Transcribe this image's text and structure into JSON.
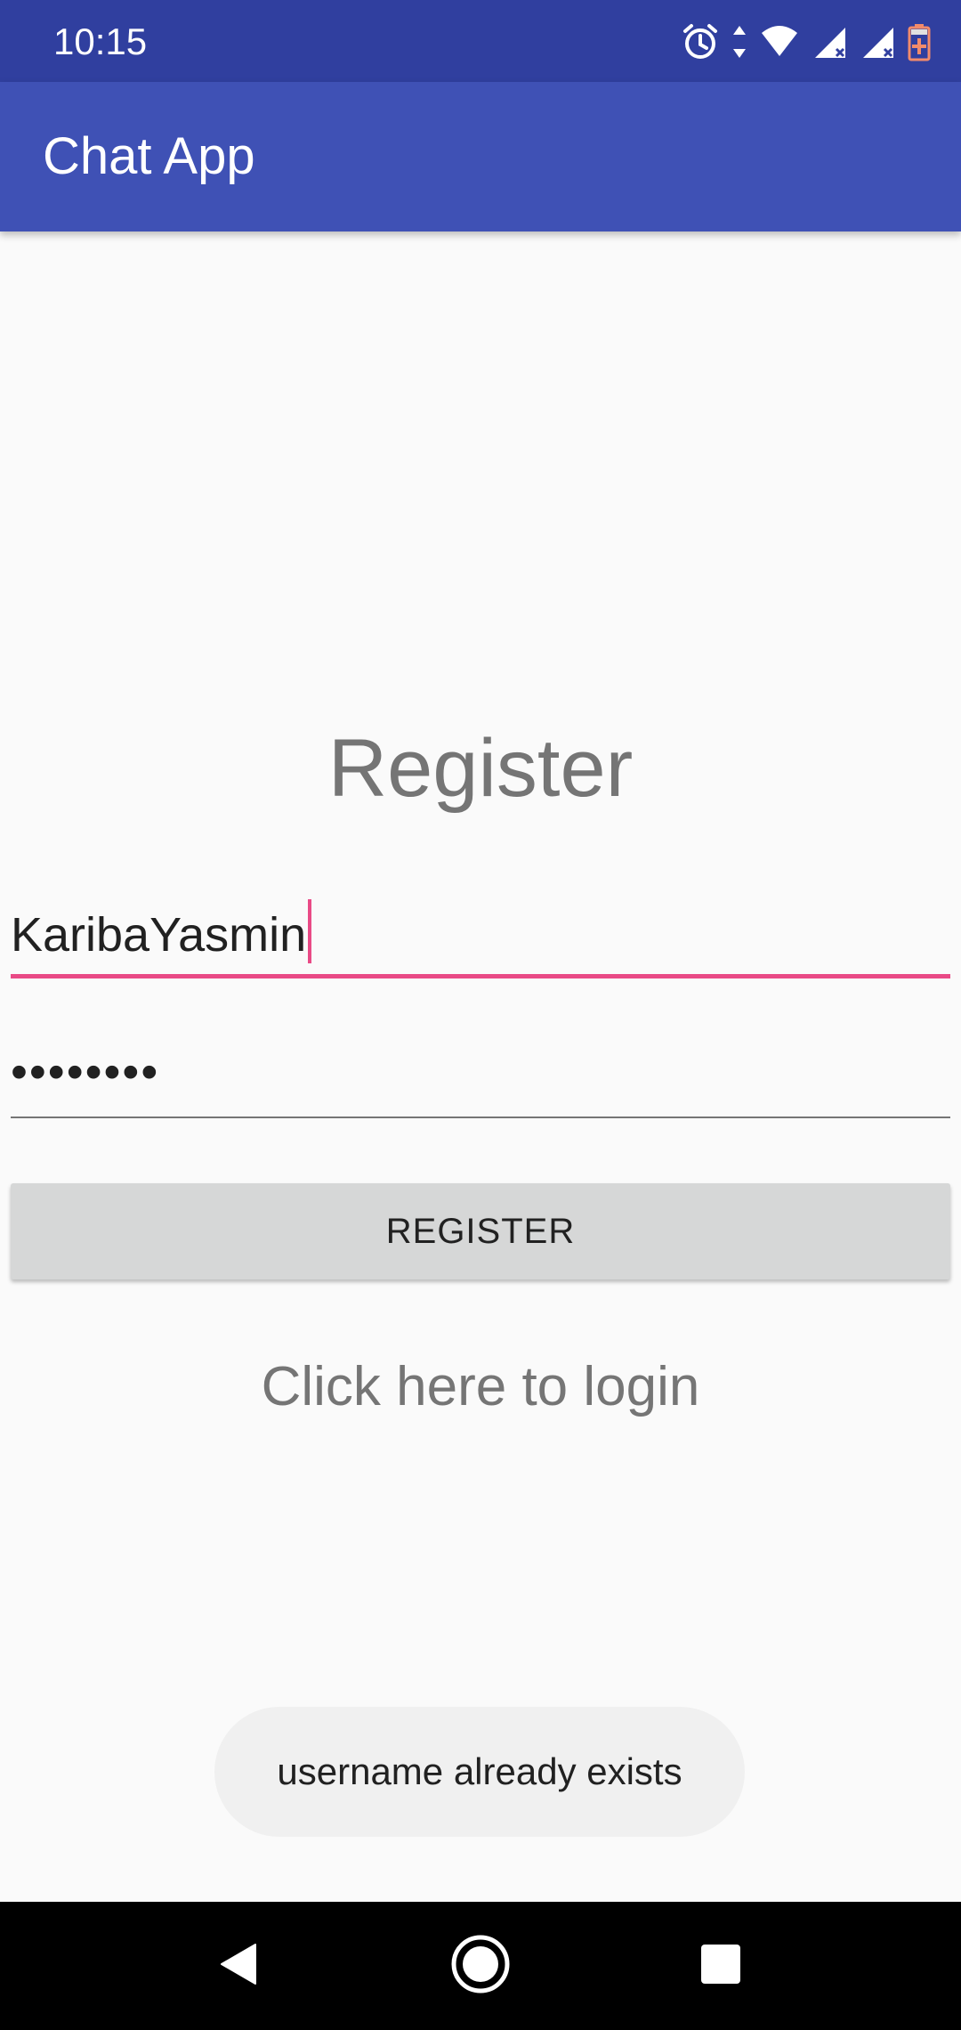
{
  "status_bar": {
    "time": "10:15",
    "icons": [
      "alarm-icon",
      "data-arrows-icon",
      "wifi-icon",
      "signal-icon",
      "signal-icon",
      "battery-charging-icon"
    ],
    "background": "#303f9f"
  },
  "app_bar": {
    "title": "Chat App",
    "background": "#3f51b5"
  },
  "form": {
    "heading": "Register",
    "username_value": "KaribaYasmin",
    "password_value": "••••••••",
    "register_button_label": "REGISTER",
    "login_link_text": "Click here to login",
    "accent": "#e94a86"
  },
  "toast": {
    "message": "username already exists"
  },
  "nav_bar": {
    "icons": [
      "back-icon",
      "home-icon",
      "recents-icon"
    ]
  }
}
